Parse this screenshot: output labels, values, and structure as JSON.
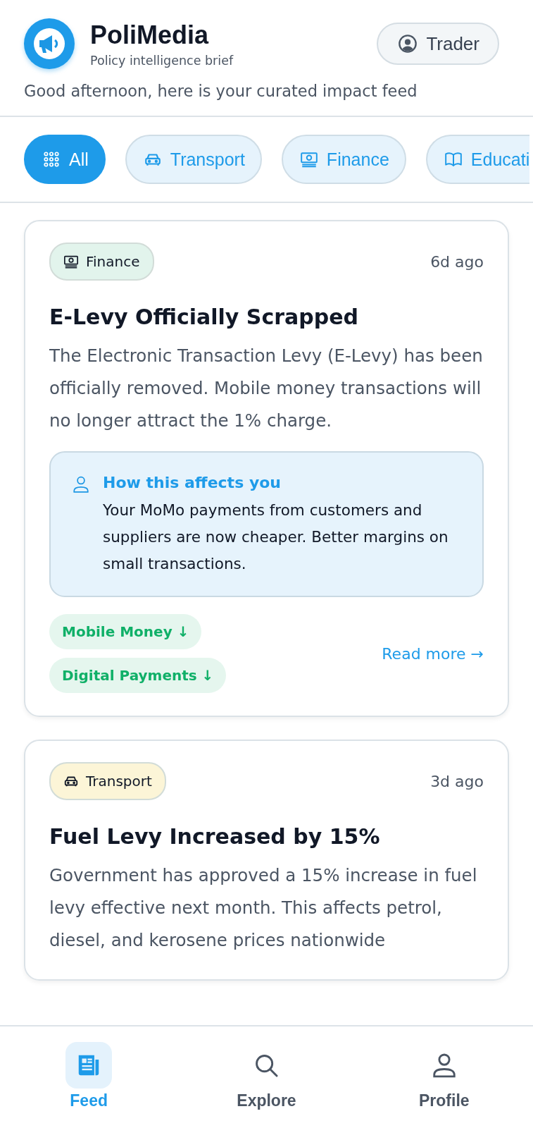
{
  "app": {
    "title": "PoliMedia",
    "subtitle": "Policy intelligence brief",
    "role_button": "Trader",
    "greeting": "Good afternoon, here is your curated impact feed"
  },
  "filters": [
    {
      "label": "All",
      "kind": "grid",
      "selected": true
    },
    {
      "label": "Transport",
      "kind": "car",
      "selected": false
    },
    {
      "label": "Finance",
      "kind": "money",
      "selected": false
    },
    {
      "label": "Educati",
      "kind": "book",
      "selected": false
    }
  ],
  "cards": [
    {
      "category": {
        "label": "Finance",
        "kind": "money",
        "color": "#e2f4ec"
      },
      "time": "6d ago",
      "title": "E-Levy Officially Scrapped",
      "body": "The Electronic Transaction Levy (E-Levy) has been officially removed. Mobile money transactions will no longer attract the 1% charge.",
      "impact": {
        "heading": "How this affects you",
        "text": "Your MoMo payments from customers and suppliers are now cheaper. Better margins on small transactions."
      },
      "tags": [
        "Mobile Money ↓",
        "Digital Payments ↓"
      ],
      "link": "Read more →"
    },
    {
      "category": {
        "label": "Transport",
        "kind": "car",
        "color": "#fcf5d7"
      },
      "time": "3d ago",
      "title": "Fuel Levy Increased by 15%",
      "body": "Government has approved a 15% increase in fuel levy effective next month. This affects petrol, diesel, and kerosene prices nationwide"
    }
  ],
  "nav": [
    {
      "label": "Feed",
      "kind": "news",
      "selected": true
    },
    {
      "label": "Explore",
      "kind": "search",
      "selected": false
    },
    {
      "label": "Profile",
      "kind": "person",
      "selected": false
    }
  ]
}
